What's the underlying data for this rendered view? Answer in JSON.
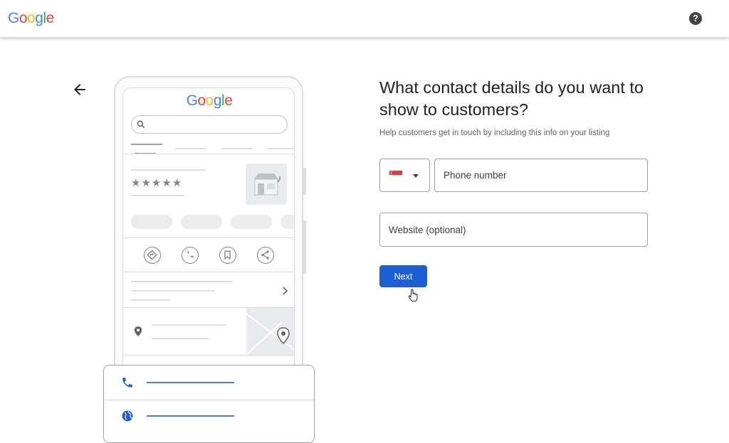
{
  "header": {
    "logo_letters": [
      {
        "ch": "G",
        "color": "#4285F4"
      },
      {
        "ch": "o",
        "color": "#EA4335"
      },
      {
        "ch": "o",
        "color": "#FBBC05"
      },
      {
        "ch": "g",
        "color": "#4285F4"
      },
      {
        "ch": "l",
        "color": "#34A853"
      },
      {
        "ch": "e",
        "color": "#EA4335"
      }
    ],
    "help_icon": "help-circle-icon",
    "help_glyph": "?"
  },
  "nav": {
    "back_icon": "arrow-back-icon"
  },
  "illustration": {
    "logo_text": "Google",
    "stars": "★★★★★",
    "actions": [
      "directions-icon",
      "call-icon",
      "bookmark-icon",
      "share-icon"
    ],
    "card_rows": [
      "phone-icon",
      "globe-icon"
    ]
  },
  "form": {
    "heading": "What contact details do you want to show to customers?",
    "subheading": "Help customers get in touch by including this info on your listing",
    "country_selector": {
      "flag": "singapore-flag-icon"
    },
    "phone_placeholder": "Phone number",
    "website_placeholder": "Website (optional)",
    "next_label": "Next"
  },
  "colors": {
    "primary_button": "#1a5fd6",
    "accent_line": "#4a7bd9"
  }
}
